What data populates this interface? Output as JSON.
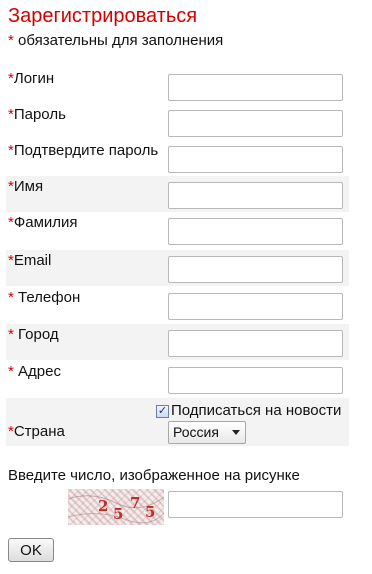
{
  "header": {
    "title": "Зарегистрироваться",
    "required_star": "*",
    "required_note": " обязательны для заполнения"
  },
  "fields": [
    {
      "star": "*",
      "label": "Логин",
      "value": "",
      "shaded": false
    },
    {
      "star": "*",
      "label": "Пароль",
      "value": "",
      "shaded": false
    },
    {
      "star": "*",
      "label": "Подтвердите пароль",
      "value": "",
      "shaded": false
    },
    {
      "star": "*",
      "label": "Имя",
      "value": "",
      "shaded": true
    },
    {
      "star": "*",
      "label": "Фамилия",
      "value": "",
      "shaded": false
    },
    {
      "star": "*",
      "label": "Email",
      "value": "",
      "shaded": true
    },
    {
      "star": "* ",
      "label": "Телефон",
      "value": "",
      "shaded": false
    },
    {
      "star": "* ",
      "label": "Город",
      "value": "",
      "shaded": true
    },
    {
      "star": "* ",
      "label": "Адрес",
      "value": "",
      "shaded": false
    }
  ],
  "subscribe": {
    "checked": true,
    "label": "Подписаться на новости"
  },
  "country": {
    "star": "*",
    "label": "Страна",
    "selected": "Россия"
  },
  "captcha": {
    "prompt": "Введите число, изображенное на рисунке",
    "code": [
      "2",
      "5",
      "7",
      "5"
    ],
    "value": ""
  },
  "actions": {
    "ok_label": "OK"
  },
  "colors": {
    "accent": "#d40000",
    "row_shade": "#f3f3f3"
  }
}
